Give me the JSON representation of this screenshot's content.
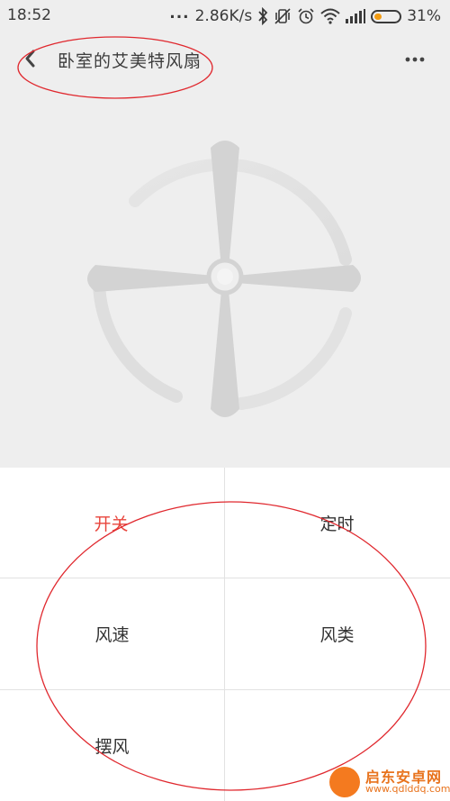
{
  "status_bar": {
    "time": "18:52",
    "dots": "...",
    "network_speed": "2.86K/s",
    "battery_text": "31%",
    "battery_level": 0.31,
    "icons": [
      "bluetooth-icon",
      "vibrate-off-icon",
      "alarm-icon",
      "wifi-icon",
      "signal-icon",
      "battery-icon"
    ]
  },
  "header": {
    "title": "卧室的艾美特风扇",
    "back_icon": "back-arrow-icon",
    "more_icon": "more-icon"
  },
  "controls": {
    "power_label": "开关",
    "timer_label": "定时",
    "speed_label": "风速",
    "type_label": "风类",
    "swing_label": "摆风"
  },
  "watermark": {
    "line1": "启东安卓网",
    "line2": "www.qdlddq.com"
  },
  "colors": {
    "accent_red": "#e8453c",
    "annotation_red": "#e0282e",
    "background_gray": "#eeeeee",
    "battery_orange": "#f39c12"
  }
}
